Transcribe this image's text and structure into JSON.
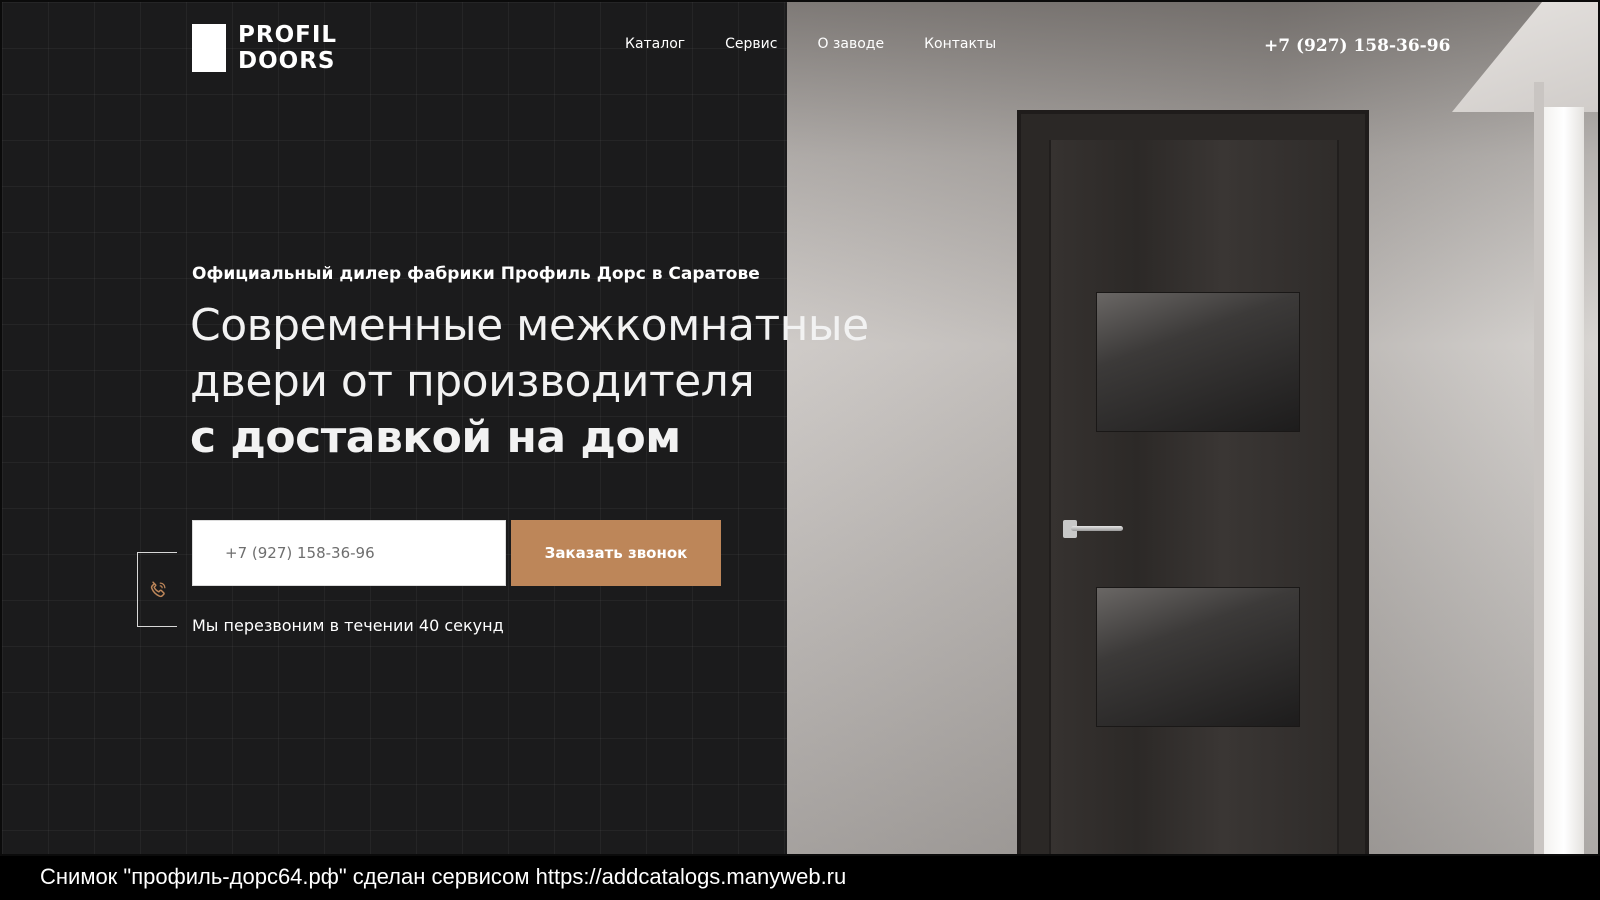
{
  "logo": {
    "line1": "PROFIL",
    "line2": "DOORS"
  },
  "nav": {
    "items": [
      "Каталог",
      "Сервис",
      "О заводе",
      "Контакты"
    ]
  },
  "header": {
    "phone": "+7 (927) 158-36-96"
  },
  "hero": {
    "subtitle": "Официальный дилер фабрики Профиль Дорс в Саратове",
    "headline_line1": "Современные межкомнатные",
    "headline_line2": "двери от производителя",
    "headline_line3": "с доставкой на дом"
  },
  "form": {
    "phone_placeholder": "+7 (927) 158-36-96",
    "button_label": "Заказать звонок",
    "note": "Мы перезвоним в течении 40 секунд"
  },
  "caption": {
    "text": "Снимок \"профиль-дорс64.рф\" сделан сервисом https://addcatalogs.manyweb.ru"
  },
  "icons": {
    "phone_widget": "phone-icon"
  },
  "colors": {
    "accent": "#bd8659",
    "dark_bg": "#1b1b1c"
  }
}
